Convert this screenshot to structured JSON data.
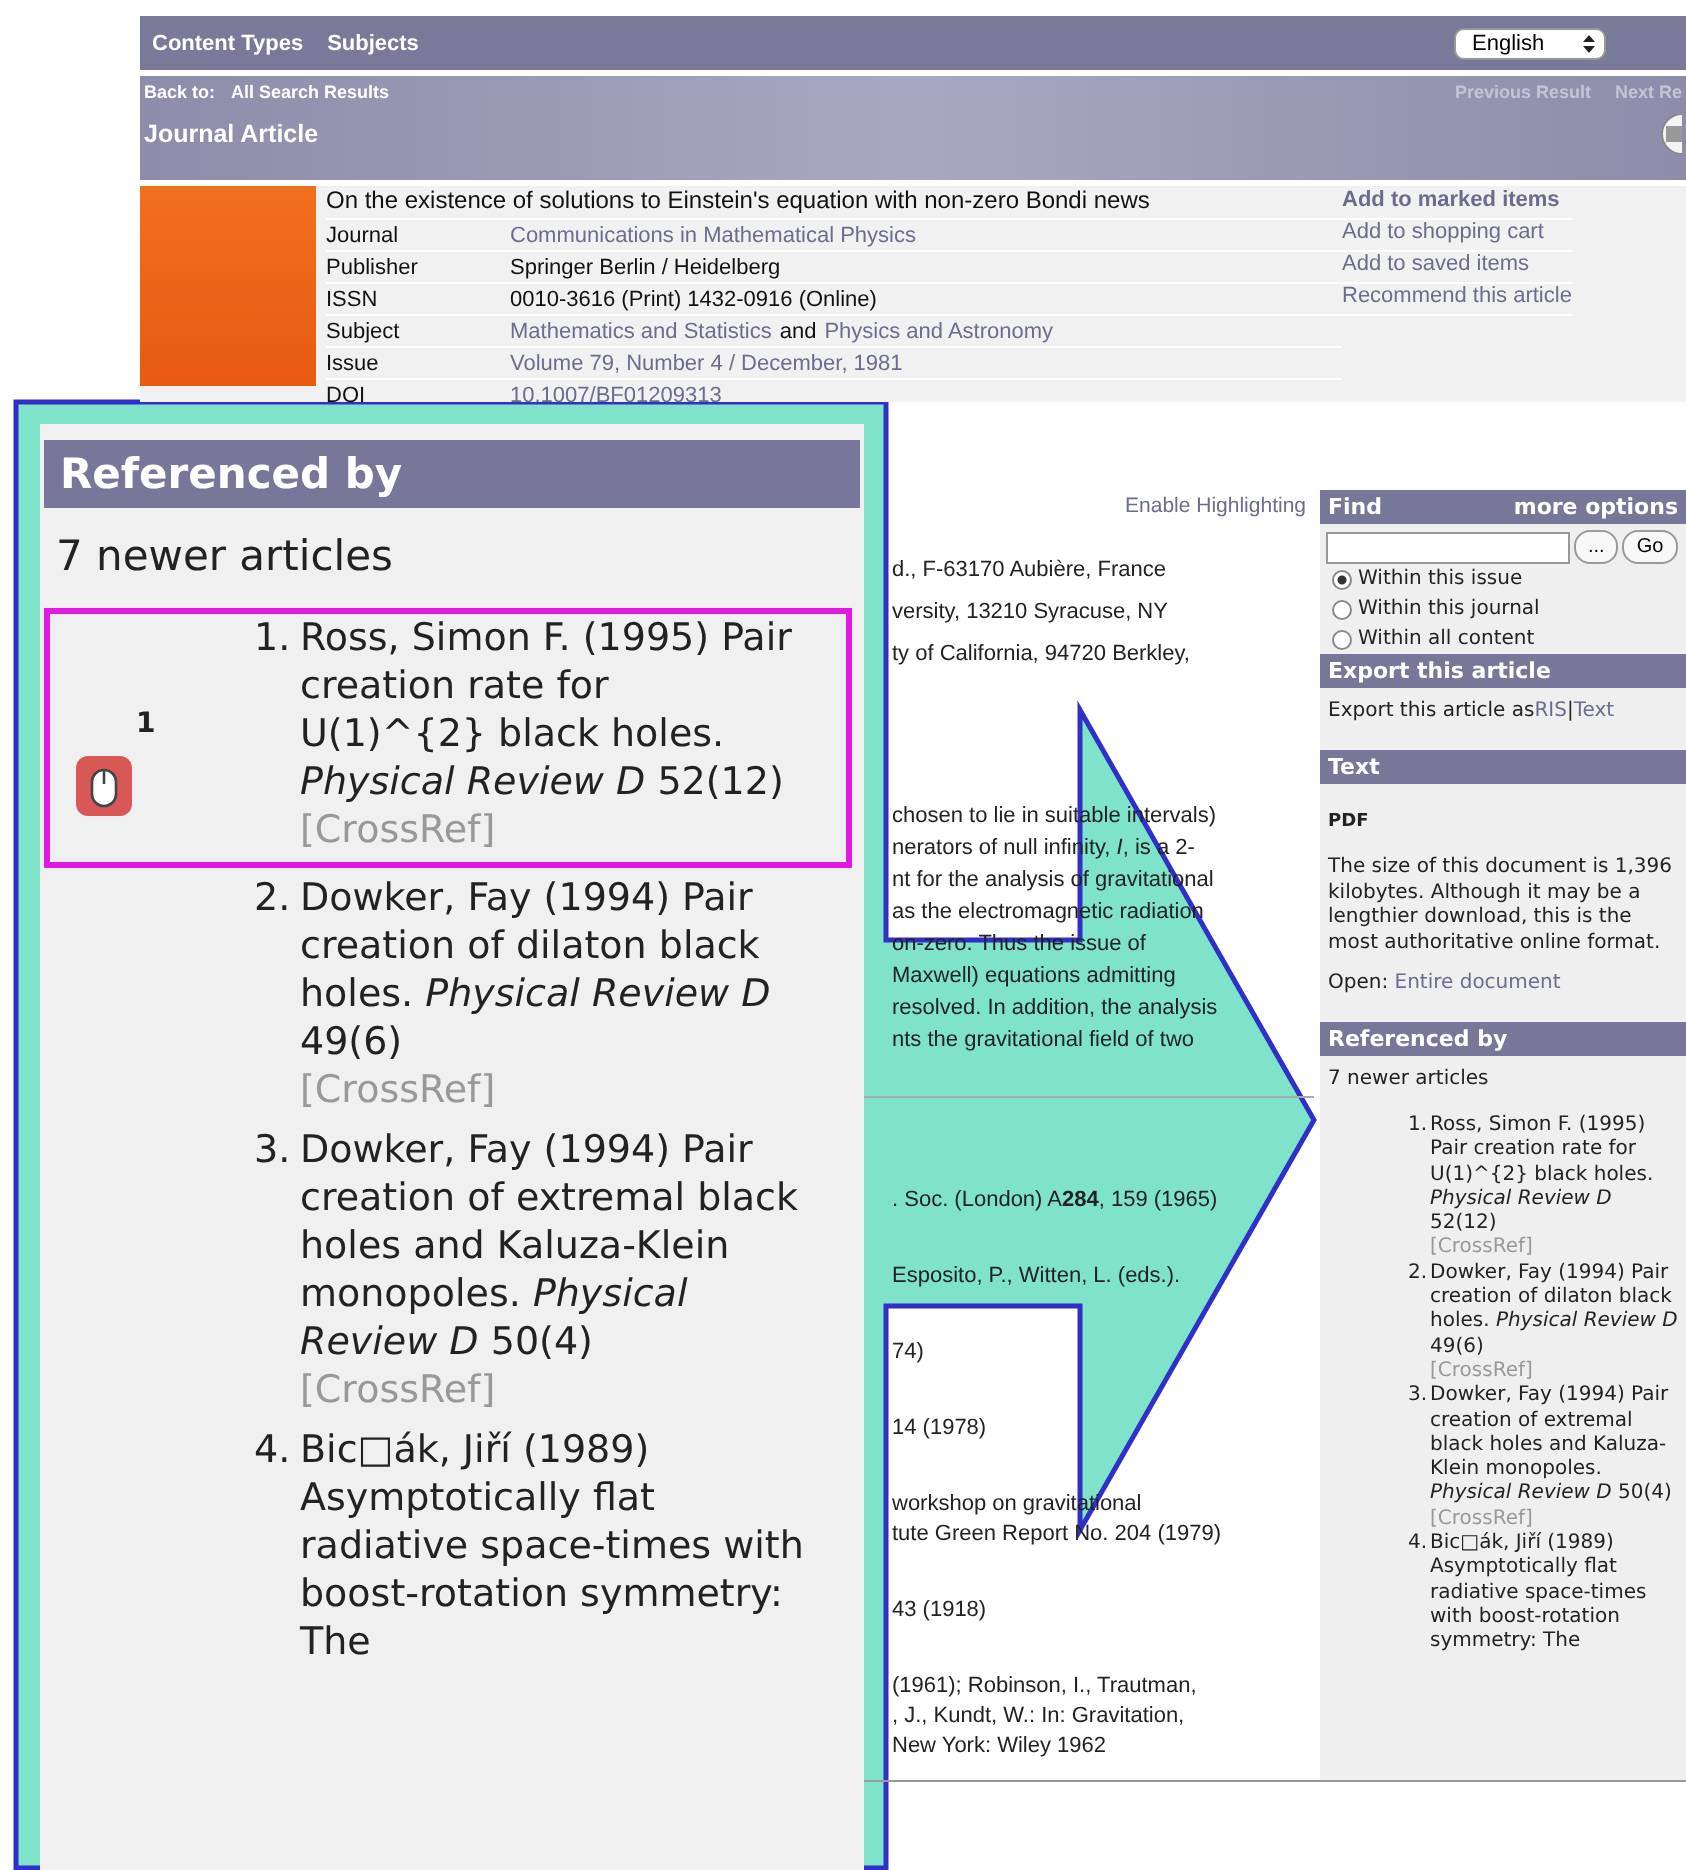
{
  "nav": {
    "links": [
      "Content Types",
      "Subjects"
    ],
    "language": "English"
  },
  "breadcrumb": {
    "label": "Back to:",
    "link": "All Search Results",
    "pager": [
      "Previous Result",
      "Next Re"
    ]
  },
  "page_title": "Journal Article",
  "article": {
    "title": "On the existence of solutions to Einstein's equation with non-zero Bondi news",
    "fields": [
      {
        "label": "Journal",
        "segments": [
          {
            "text": "Communications in Mathematical Physics",
            "link": true
          }
        ]
      },
      {
        "label": "Publisher",
        "segments": [
          {
            "text": "Springer Berlin / Heidelberg",
            "link": false
          }
        ]
      },
      {
        "label": "ISSN",
        "segments": [
          {
            "text": "0010-3616 (Print) 1432-0916 (Online)",
            "link": false
          }
        ]
      },
      {
        "label": "Subject",
        "segments": [
          {
            "text": "Mathematics and Statistics",
            "link": true
          },
          {
            "text": "and",
            "link": false
          },
          {
            "text": "Physics and Astronomy",
            "link": true
          }
        ]
      },
      {
        "label": "Issue",
        "segments": [
          {
            "text": "Volume 79, Number 4 / December, 1981",
            "link": true
          }
        ]
      },
      {
        "label": "DOI",
        "segments": [
          {
            "text": "10.1007/BF01209313",
            "link": true
          }
        ]
      }
    ],
    "actions": [
      {
        "label": "Add to marked items",
        "bold": true
      },
      {
        "label": "Add to shopping cart",
        "bold": false
      },
      {
        "label": "Add to saved items",
        "bold": false
      },
      {
        "label": "Recommend this article",
        "bold": false
      }
    ]
  },
  "main": {
    "highlight_link": "Enable Highlighting",
    "affiliations": [
      "d., F-63170 Aubière, France",
      "versity, 13210 Syracuse, NY",
      "ty of California, 94720 Berkley,"
    ],
    "abstract_lines": [
      "chosen to lie in suitable intervals)",
      "nerators of null infinity, *I*, is a 2-",
      "nt for the analysis of gravitational",
      "as the electromagnetic radiation",
      "on-zero. Thus the issue of",
      "Maxwell) equations admitting",
      "resolved. In addition, the analysis",
      "nts the gravitational field of two"
    ],
    "references": [
      {
        "lines": [
          ". Soc. (London) A**284**, 159 (1965)"
        ]
      },
      {
        "lines": [
          "Esposito, P., Witten, L. (eds.)."
        ]
      },
      {
        "lines": [
          "74)"
        ]
      },
      {
        "lines": [
          "14 (1978)"
        ]
      },
      {
        "lines": [
          "workshop on gravitational",
          "tute Green Report No. 204 (1979)"
        ]
      },
      {
        "lines": [
          "43 (1918)"
        ]
      },
      {
        "lines": [
          "(1961); Robinson, I., Trautman,",
          ", J., Kundt, W.: In: Gravitation,",
          "New York: Wiley 1962"
        ]
      }
    ]
  },
  "sidebar": {
    "find": {
      "title": "Find",
      "more": "more options",
      "browse_button": "...",
      "go_button": "Go",
      "scopes": [
        {
          "label": "Within this issue",
          "selected": true
        },
        {
          "label": "Within this journal",
          "selected": false
        },
        {
          "label": "Within all content",
          "selected": false
        }
      ]
    },
    "export": {
      "title": "Export this article",
      "text": "Export this article as",
      "formats": [
        "RIS",
        "Text"
      ],
      "separator": "|"
    },
    "fulltext": {
      "title": "Text",
      "format": "PDF",
      "description": "The size of this document is 1,396 kilobytes. Although it may be a lengthier download, this is the most authoritative online format.",
      "open_label": "Open:",
      "open_link": "Entire document"
    },
    "referenced_by": {
      "title": "Referenced by",
      "count": "7 newer articles",
      "items": [
        {
          "number": "1.",
          "text": "Ross, Simon F. (1995) Pair creation rate for U(1)^{2} black holes. *Physical Review D* 52(12)",
          "crossref": "[CrossRef]"
        },
        {
          "number": "2.",
          "text": "Dowker, Fay (1994) Pair creation of dilaton black holes. *Physical Review D* 49(6)",
          "crossref": "[CrossRef]"
        },
        {
          "number": "3.",
          "text": "Dowker, Fay (1994) Pair creation of extremal black holes and Kaluza-Klein monopoles. *Physical Review D* 50(4)",
          "crossref": "[CrossRef]"
        },
        {
          "number": "4.",
          "text": "Bic□ák, Jiří (1989) Asymptotically flat radiative space-times with boost-rotation symmetry: The"
        }
      ]
    }
  },
  "zoom_panel": {
    "title": "Referenced by",
    "count": "7 newer articles",
    "items": [
      {
        "number": "1.",
        "text": "Ross, Simon F. (1995) Pair creation rate for U(1)^{2} black holes. *Physical Review D* 52(12)",
        "crossref": "[CrossRef]",
        "selected": true,
        "icon_badge": "1"
      },
      {
        "number": "2.",
        "text": "Dowker, Fay (1994) Pair creation of dilaton black holes. *Physical Review D* 49(6)",
        "crossref": "[CrossRef]",
        "selected": false
      },
      {
        "number": "3.",
        "text": "Dowker, Fay (1994) Pair creation of extremal black holes and Kaluza-Klein monopoles. *Physical Review D* 50(4)",
        "crossref": "[CrossRef]",
        "selected": false
      },
      {
        "number": "4.",
        "text": "Bic□ák, Jiří (1989) Asymptotically flat radiative space-times with boost-rotation symmetry: The",
        "selected": false
      }
    ]
  }
}
